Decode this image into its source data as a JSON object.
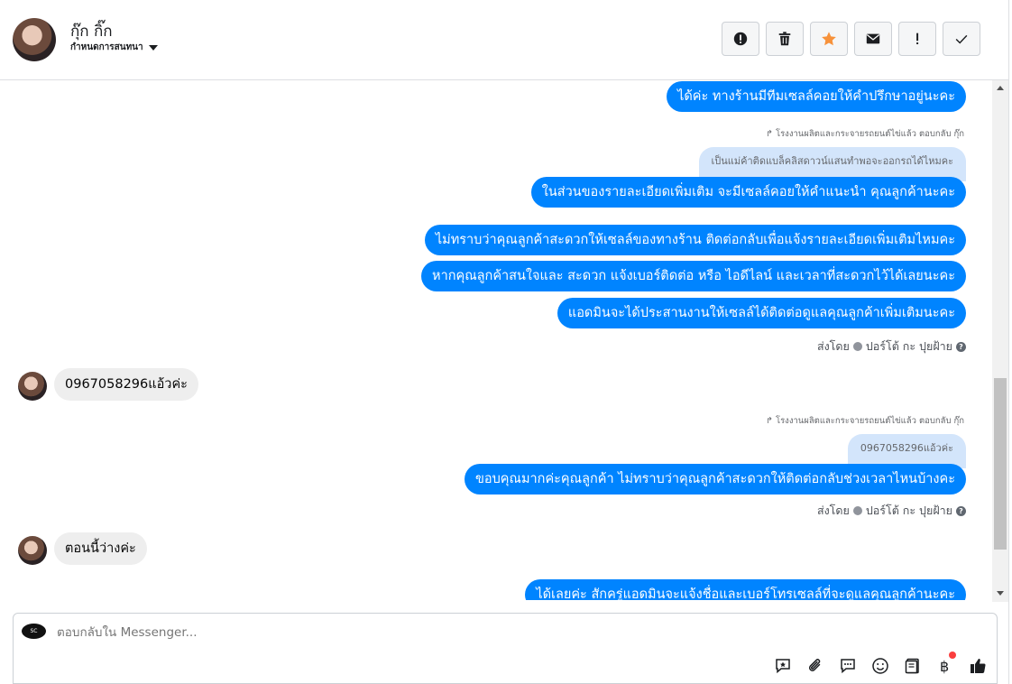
{
  "header": {
    "contact_name": "กุ๊ก กิ๊ก",
    "assign_label": "กำหนดการสนทนา"
  },
  "actions": [
    {
      "name": "spam-button",
      "icon": "exclamation-circle-icon"
    },
    {
      "name": "delete-button",
      "icon": "trash-icon"
    },
    {
      "name": "star-button",
      "icon": "star-icon",
      "color": "#f7923b"
    },
    {
      "name": "mark-unread-button",
      "icon": "envelope-icon"
    },
    {
      "name": "follow-up-button",
      "icon": "exclamation-icon"
    },
    {
      "name": "mark-done-button",
      "icon": "checkmark-icon"
    }
  ],
  "messages": {
    "m1": "ได้ค่ะ ทางร้านมีทีมเซลล์คอยให้คำปรึกษาอยู่นะคะ",
    "reply_note_1": "โรงงานผลิตและกระจายรถยนต์ไข่แล้ว ตอบกลับ กุ๊ก",
    "quote_1": "เป็นแม่ค้าติดแบล็คลิสดาวน์แสนทำพอจะออกรถได้ไหมคะ",
    "m2": "ในส่วนของรายละเอียดเพิ่มเติม จะมีเซลล์คอยให้คำแนะนำ คุณลูกค้านะคะ",
    "m3": "ไม่ทราบว่าคุณลูกค้าสะดวกให้เซลล์ของทางร้าน ติดต่อกลับเพื่อแจ้งรายละเอียดเพิ่มเติมไหมคะ",
    "m4": "หากคุณลูกค้าสนใจและ สะดวก แจ้งเบอร์ติดต่อ หรือ ไอดีไลน์ และเวลาที่สะดวกไว้ได้เลยนะคะ",
    "m5": "แอดมินจะได้ประสานงานให้เซลล์ได้ติดต่อดูแลคุณลูกค้าเพิ่มเติมนะคะ",
    "sent_by_1": "ส่งโดย",
    "sender_1": "ปอร์โต้ กะ ปุยฝ้าย",
    "in1": "0967058296แอ้วค่ะ",
    "reply_note_2": "โรงงานผลิตและกระจายรถยนต์ไข่แล้ว ตอบกลับ กุ๊ก",
    "quote_2": "0967058296แอ้วค่ะ",
    "m6": "ขอบคุณมากค่ะคุณลูกค้า ไม่ทราบว่าคุณลูกค้าสะดวกให้ติดต่อกลับช่วงเวลาไหนบ้างคะ",
    "sent_by_2": "ส่งโดย",
    "sender_2": "ปอร์โต้ กะ ปุยฝ้าย",
    "in2": "ตอนนี้ว่างค่ะ",
    "m7": "ได้เลยค่ะ สักครู่แอดมินจะแจ้งชื่อและเบอร์โทรเซลล์ที่จะดูแลคุณลูกค้านะคะ"
  },
  "composer": {
    "placeholder": "ตอบกลับใน Messenger...",
    "page_logo_text": "SC"
  },
  "colors": {
    "outgoing_bubble": "#0084ff",
    "incoming_bubble": "#eeeeee",
    "quoted_bubble": "#d3e5fb",
    "like_icon": "#1c1e21"
  }
}
